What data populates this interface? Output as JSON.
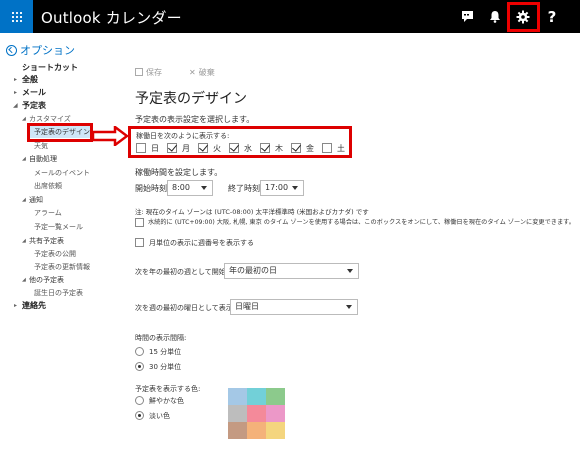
{
  "header": {
    "app_title": "Outlook カレンダー",
    "icons": [
      "app-launcher-icon",
      "chat-icon",
      "bell-icon",
      "gear-icon",
      "help-icon"
    ]
  },
  "back": {
    "label": "オプション"
  },
  "sidebar": {
    "shortcuts": "ショートカット",
    "general": "全般",
    "mail": "メール",
    "calendar": "予定表",
    "customize": "カスタマイズ",
    "calendar_appearance": "予定表のデザイン",
    "weather": "天気",
    "auto_processing": "自動処理",
    "mail_events": "メールのイベント",
    "invitations": "出席依頼",
    "notifications": "通知",
    "alarms": "アラーム",
    "agenda_mail": "予定一覧メール",
    "shared_calendars": "共有予定表",
    "publish_calendar": "予定表の公開",
    "calendar_updates": "予定表の更新情報",
    "other_calendars": "他の予定表",
    "birthday_calendar": "誕生日の予定表",
    "contacts": "連絡先"
  },
  "toolbar": {
    "save": "保存",
    "discard": "破棄"
  },
  "page": {
    "title": "予定表のデザイン",
    "intro": "予定表の表示設定を選択します。",
    "show_days_label": "稼働日を次のように表示する:",
    "days": [
      {
        "label": "日",
        "checked": false
      },
      {
        "label": "月",
        "checked": true
      },
      {
        "label": "火",
        "checked": true
      },
      {
        "label": "水",
        "checked": true
      },
      {
        "label": "木",
        "checked": true
      },
      {
        "label": "金",
        "checked": true
      },
      {
        "label": "土",
        "checked": false
      }
    ],
    "hours_label": "稼働時間を設定します。",
    "start_label": "開始時刻",
    "start_value": "8:00",
    "end_label": "終了時刻",
    "end_value": "17:00",
    "note_line1": "注: 現在のタイム ゾーンは (UTC-08:00) 太平洋標準時 (米国およびカナダ) です",
    "note_line2": "水続的に (UTC+09:00) 大阪, 札幌, 東京 のタイム ゾーンを使用する場合は、このボックスをオンにして、稼働日を現在のタイム ゾーンに変更できます。",
    "week_numbers_label": "月単位の表示に週番号を表示する",
    "first_week_label": "次を年の最初の週として開始:",
    "first_week_value": "年の最初の日",
    "first_day_label": "次を週の最初の曜日として表示:",
    "first_day_value": "日曜日",
    "time_scale_label": "時間の表示間隔:",
    "time_scale_15": "15 分単位",
    "time_scale_30": "30 分単位",
    "time_scale_selected": "30 分単位",
    "color_label": "予定表を表示する色:",
    "color_bright": "鮮やかな色",
    "color_light": "淡い色",
    "color_selected": "淡い色",
    "swatches": [
      "#a4c8e6",
      "#72d0d8",
      "#8cca8c",
      "#bdbdbd",
      "#f48a9a",
      "#ec98c8",
      "#c49a82",
      "#f4b27a",
      "#f4d57e"
    ]
  }
}
